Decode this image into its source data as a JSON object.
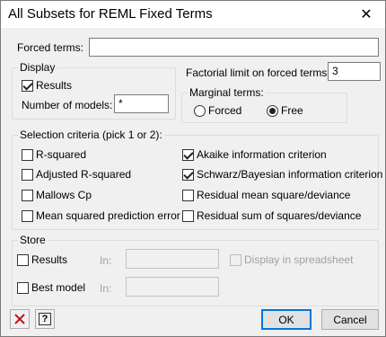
{
  "window": {
    "title": "All Subsets for REML Fixed Terms",
    "close_glyph": "✕"
  },
  "forced_terms": {
    "label": "Forced terms:",
    "value": ""
  },
  "display": {
    "title": "Display",
    "results_label": "Results",
    "results_checked": true,
    "num_models_label": "Number of models:",
    "num_models_value": "*"
  },
  "factorial": {
    "label": "Factorial limit on forced terms:",
    "value": "3"
  },
  "marginal": {
    "title": "Marginal terms:",
    "options": [
      {
        "label": "Forced",
        "selected": false
      },
      {
        "label": "Free",
        "selected": true
      }
    ]
  },
  "criteria": {
    "title": "Selection criteria (pick 1 or 2):",
    "left": [
      {
        "label": "R-squared",
        "checked": false
      },
      {
        "label": "Adjusted R-squared",
        "checked": false
      },
      {
        "label": "Mallows Cp",
        "checked": false
      },
      {
        "label": "Mean squared prediction error",
        "checked": false
      }
    ],
    "right": [
      {
        "label": "Akaike information criterion",
        "checked": true
      },
      {
        "label": "Schwarz/Bayesian information criterion",
        "checked": true
      },
      {
        "label": "Residual mean square/deviance",
        "checked": false
      },
      {
        "label": "Residual sum of squares/deviance",
        "checked": false
      }
    ]
  },
  "store": {
    "title": "Store",
    "results_label": "Results",
    "in_label": "In:",
    "display_spreadsheet_label": "Display in spreadsheet",
    "best_model_label": "Best model"
  },
  "buttons": {
    "ok": "OK",
    "cancel": "Cancel",
    "help_glyph": "?"
  }
}
